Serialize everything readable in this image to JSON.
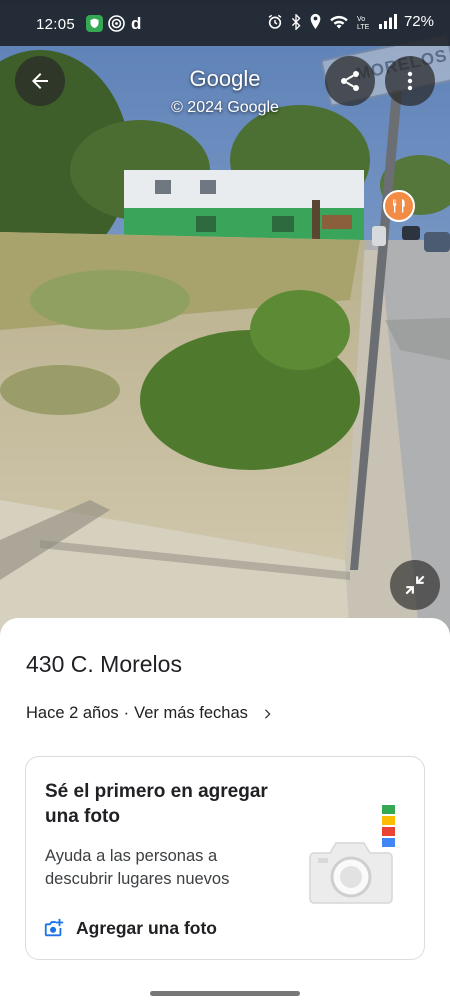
{
  "status_bar": {
    "time": "12:05",
    "app_letter": "d",
    "battery": "72%"
  },
  "header": {
    "title": "Google",
    "subtitle": "© 2024 Google"
  },
  "street_sign": "MORELOS",
  "place": {
    "address": "430 C. Morelos",
    "date_text": "Hace 2 años",
    "separator": "·",
    "more_dates": "Ver más fechas"
  },
  "card": {
    "title": "Sé el primero en agregar una foto",
    "description": "Ayuda a las personas a descubrir lugares nuevos",
    "action_label": "Agregar una foto"
  },
  "colors": {
    "poi_pin": "#f28b44",
    "link_blue": "#1a73e8",
    "google_blue": "#4285f4",
    "google_red": "#ea4335",
    "google_yellow": "#fbbc04",
    "google_green": "#34a853"
  },
  "icons": [
    "back-arrow-icon",
    "share-icon",
    "more-vert-icon",
    "fork-knife-icon",
    "collapse-icon",
    "chevron-right-icon",
    "add-photo-icon",
    "camera-icon"
  ]
}
